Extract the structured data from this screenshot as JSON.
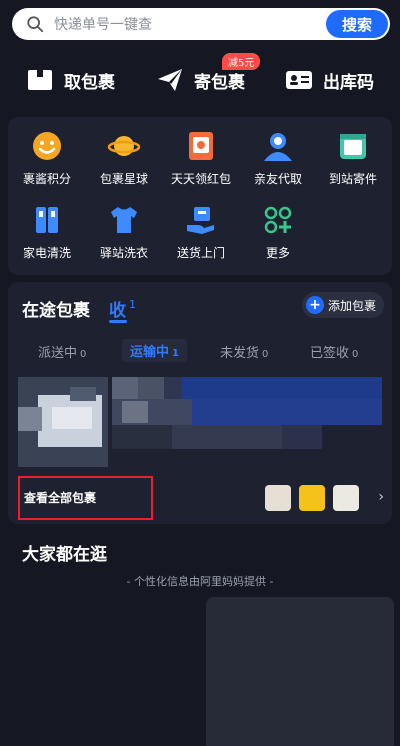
{
  "search": {
    "placeholder": "快递单号一键查",
    "button_label": "搜索"
  },
  "actions": [
    {
      "label": "取包裹",
      "icon": "box-icon"
    },
    {
      "label": "寄包裹",
      "icon": "paper-plane-icon"
    },
    {
      "label": "出库码",
      "icon": "id-card-icon"
    }
  ],
  "send_badge": "减5元",
  "services": [
    {
      "label": "裹酱积分",
      "icon": "smiley-face-icon",
      "color": "#f5a623"
    },
    {
      "label": "包裹星球",
      "icon": "planet-icon",
      "color": "#f7b731"
    },
    {
      "label": "天天领红包",
      "icon": "red-envelope-icon",
      "color": "#f26b3a"
    },
    {
      "label": "亲友代取",
      "icon": "person-icon",
      "color": "#3d8bff"
    },
    {
      "label": "到站寄件",
      "icon": "mailbox-icon",
      "color": "#43c6ac"
    },
    {
      "label": "家电清洗",
      "icon": "appliance-icon",
      "color": "#3d8bff"
    },
    {
      "label": "驿站洗衣",
      "icon": "tshirt-icon",
      "color": "#3d8bff"
    },
    {
      "label": "送货上门",
      "icon": "delivery-hand-icon",
      "color": "#3d8bff"
    },
    {
      "label": "更多",
      "icon": "grid-plus-icon",
      "color": "#36c98b"
    }
  ],
  "parcel": {
    "title": "在途包裹",
    "receive_label": "收",
    "receive_count": "1",
    "add_label": "添加包裹",
    "tabs": [
      {
        "label": "派送中",
        "count": "0"
      },
      {
        "label": "运输中",
        "count": "1"
      },
      {
        "label": "未发货",
        "count": "0"
      },
      {
        "label": "已签收",
        "count": "0"
      }
    ],
    "view_all": "查看全部包裹"
  },
  "feed": {
    "title": "大家都在逛",
    "subtitle": "- 个性化信息由阿里妈妈提供 -"
  }
}
